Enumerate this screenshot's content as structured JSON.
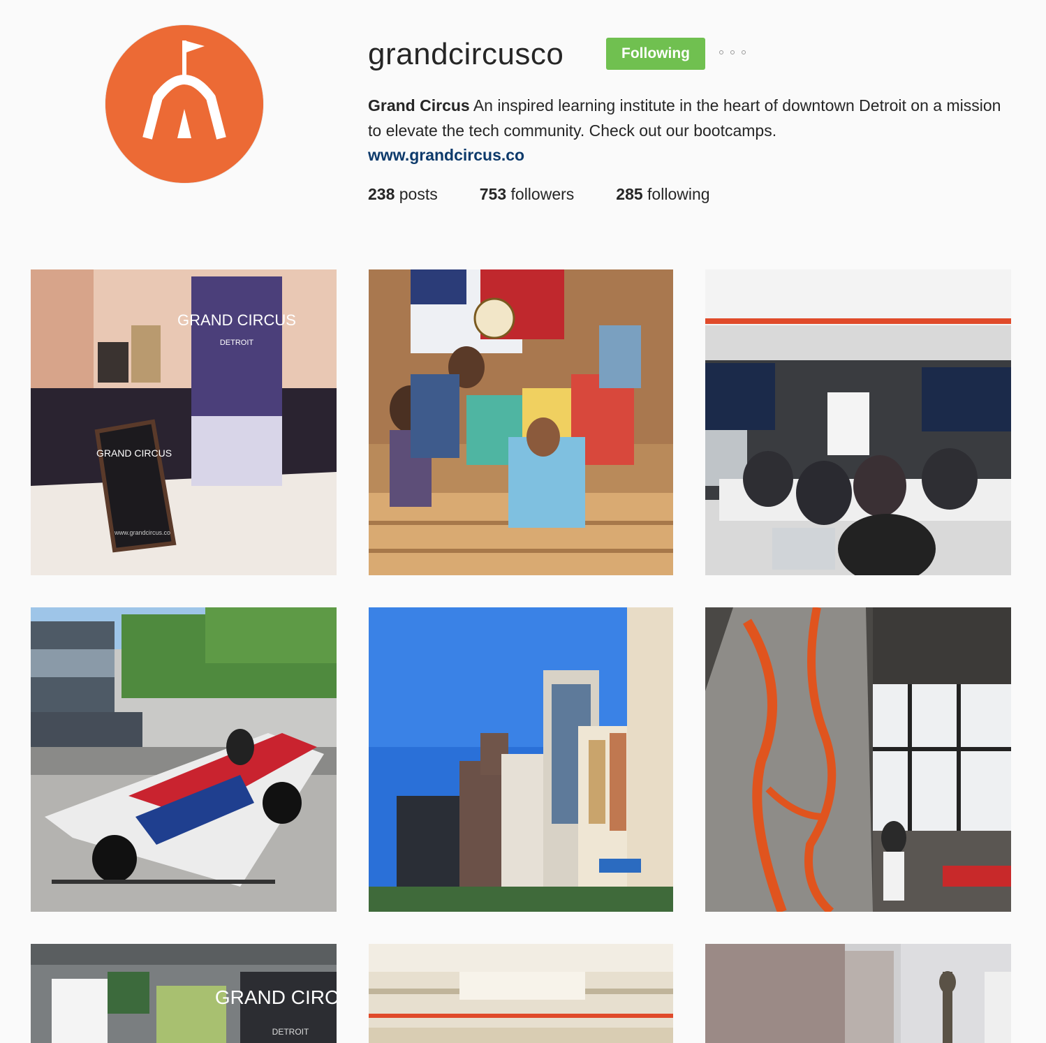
{
  "profile": {
    "username": "grandcircusco",
    "follow_label": "Following",
    "bio_name": "Grand Circus",
    "bio_text": " An inspired learning institute in the heart of downtown Detroit on a mission to elevate the tech community. Check out our bootcamps.",
    "website": "www.grandcircus.co"
  },
  "stats": {
    "posts_count": "238",
    "posts_label": " posts",
    "followers_count": "753",
    "followers_label": " followers",
    "following_count": "285",
    "following_label": " following"
  },
  "colors": {
    "brand_orange": "#ec6a35",
    "following_green": "#70c050",
    "link_blue": "#0d3a6b"
  },
  "posts": {
    "p1": {
      "banner_text": "GRAND CIRCUS",
      "banner_sub": "DETROIT",
      "sign_text": "GRAND CIRCUS",
      "sign_url": "www.grandcircus.co"
    },
    "p7": {
      "banner_text": "GRAND CIRCUS",
      "banner_sub": "DETROIT"
    }
  }
}
